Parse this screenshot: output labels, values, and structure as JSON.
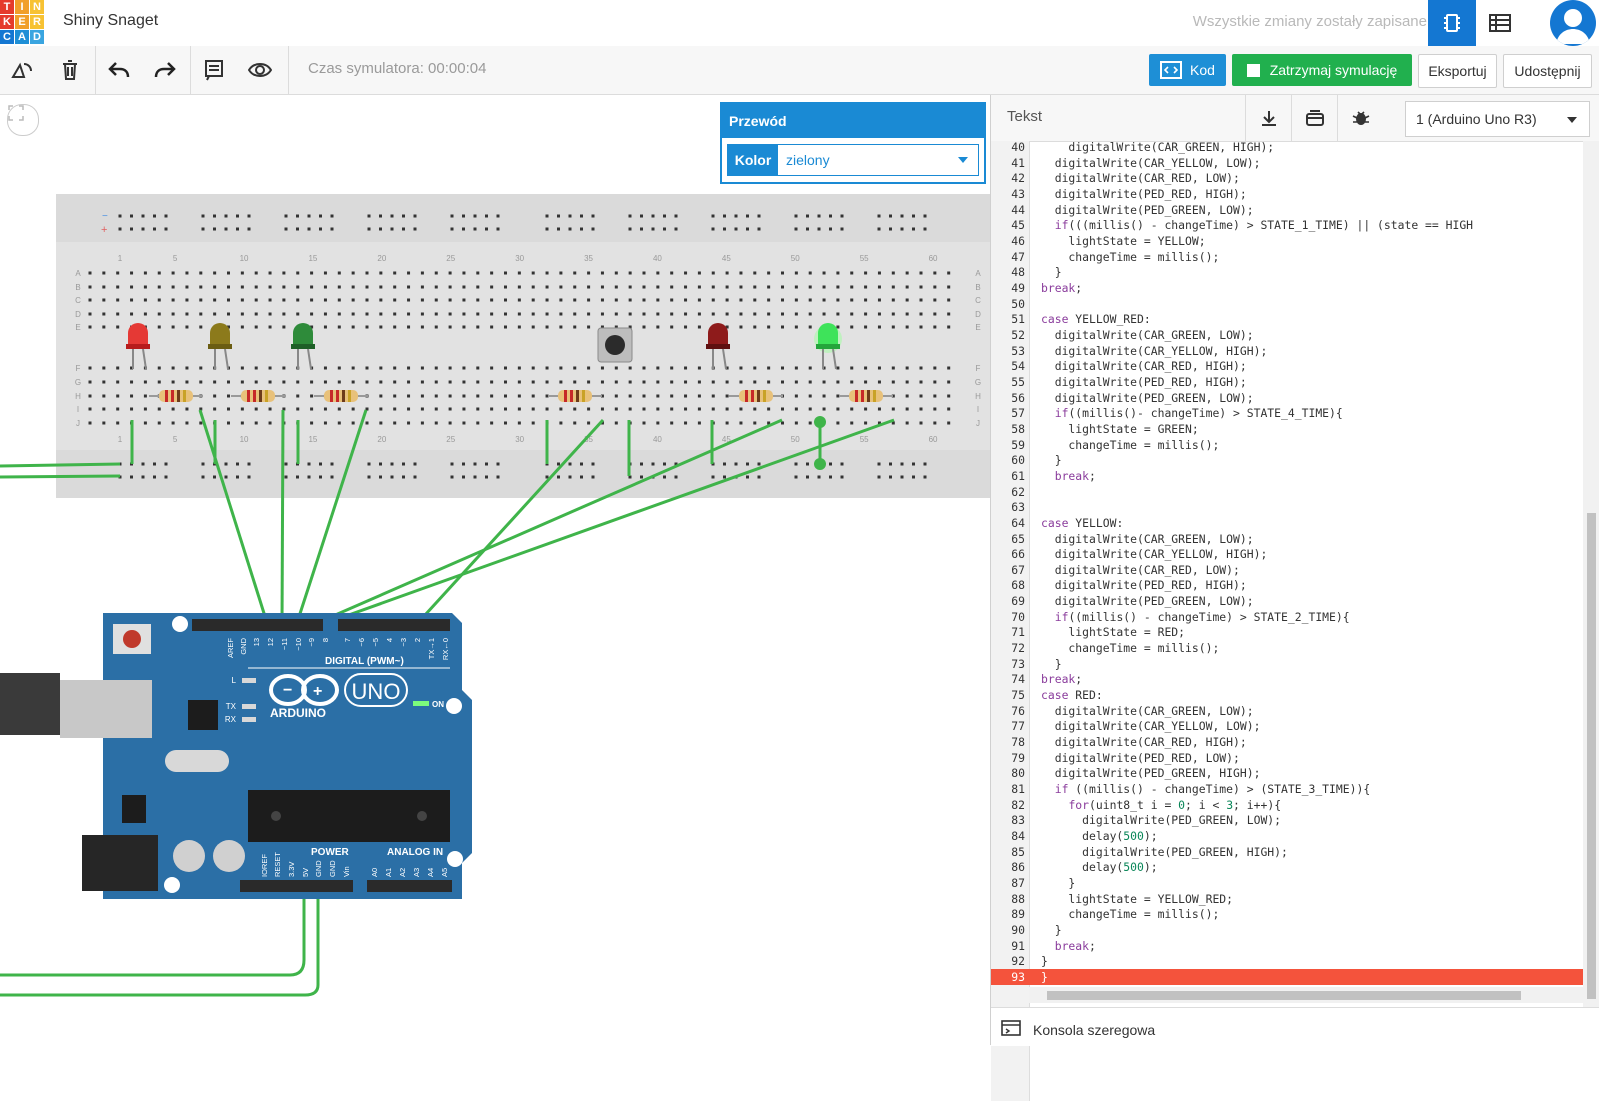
{
  "app": {
    "logo_letters": [
      "T",
      "I",
      "N",
      "K",
      "E",
      "R",
      "C",
      "A",
      "D"
    ],
    "project_name": "Shiny Snaget",
    "save_status": "Wszystkie zmiany zostały zapisane"
  },
  "toolbar": {
    "sim_time": "Czas symulatora: 00:00:04",
    "code_label": "Kod",
    "stop_label": "Zatrzymaj symulację",
    "export_label": "Eksportuj",
    "share_label": "Udostępnij"
  },
  "wire_panel": {
    "title": "Przewód",
    "color_label": "Kolor",
    "color_value": "zielony"
  },
  "code_panel": {
    "mode_label": "Tekst",
    "device": "1 (Arduino Uno R3)",
    "serial_label": "Konsola szeregowa",
    "lines": [
      {
        "n": "40",
        "t": "    digitalWrite(CAR_GREEN, HIGH);"
      },
      {
        "n": "41",
        "t": "  digitalWrite(CAR_YELLOW, LOW);"
      },
      {
        "n": "42",
        "t": "  digitalWrite(CAR_RED, LOW);"
      },
      {
        "n": "43",
        "t": "  digitalWrite(PED_RED, HIGH);"
      },
      {
        "n": "44",
        "t": "  digitalWrite(PED_GREEN, LOW);"
      },
      {
        "n": "45",
        "t": "  if(((millis() - changeTime) > STATE_1_TIME) || (state == HIGH"
      },
      {
        "n": "46",
        "t": "    lightState = YELLOW;"
      },
      {
        "n": "47",
        "t": "    changeTime = millis();"
      },
      {
        "n": "48",
        "t": "  }"
      },
      {
        "n": "49",
        "t": "break;"
      },
      {
        "n": "50",
        "t": ""
      },
      {
        "n": "51",
        "t": "case YELLOW_RED:"
      },
      {
        "n": "52",
        "t": "  digitalWrite(CAR_GREEN, LOW);"
      },
      {
        "n": "53",
        "t": "  digitalWrite(CAR_YELLOW, HIGH);"
      },
      {
        "n": "54",
        "t": "  digitalWrite(CAR_RED, HIGH);"
      },
      {
        "n": "55",
        "t": "  digitalWrite(PED_RED, HIGH);"
      },
      {
        "n": "56",
        "t": "  digitalWrite(PED_GREEN, LOW);"
      },
      {
        "n": "57",
        "t": "  if((millis()- changeTime) > STATE_4_TIME){"
      },
      {
        "n": "58",
        "t": "    lightState = GREEN;"
      },
      {
        "n": "59",
        "t": "    changeTime = millis();"
      },
      {
        "n": "60",
        "t": "  }"
      },
      {
        "n": "61",
        "t": "  break;"
      },
      {
        "n": "62",
        "t": ""
      },
      {
        "n": "63",
        "t": ""
      },
      {
        "n": "64",
        "t": "case YELLOW:"
      },
      {
        "n": "65",
        "t": "  digitalWrite(CAR_GREEN, LOW);"
      },
      {
        "n": "66",
        "t": "  digitalWrite(CAR_YELLOW, HIGH);"
      },
      {
        "n": "67",
        "t": "  digitalWrite(CAR_RED, LOW);"
      },
      {
        "n": "68",
        "t": "  digitalWrite(PED_RED, HIGH);"
      },
      {
        "n": "69",
        "t": "  digitalWrite(PED_GREEN, LOW);"
      },
      {
        "n": "70",
        "t": "  if((millis() - changeTime) > STATE_2_TIME){"
      },
      {
        "n": "71",
        "t": "    lightState = RED;"
      },
      {
        "n": "72",
        "t": "    changeTime = millis();"
      },
      {
        "n": "73",
        "t": "  }"
      },
      {
        "n": "74",
        "t": "break;"
      },
      {
        "n": "75",
        "t": "case RED:"
      },
      {
        "n": "76",
        "t": "  digitalWrite(CAR_GREEN, LOW);"
      },
      {
        "n": "77",
        "t": "  digitalWrite(CAR_YELLOW, LOW);"
      },
      {
        "n": "78",
        "t": "  digitalWrite(CAR_RED, HIGH);"
      },
      {
        "n": "79",
        "t": "  digitalWrite(PED_RED, LOW);"
      },
      {
        "n": "80",
        "t": "  digitalWrite(PED_GREEN, HIGH);"
      },
      {
        "n": "81",
        "t": "  if ((millis() - changeTime) > (STATE_3_TIME)){"
      },
      {
        "n": "82",
        "t": "    for(uint8_t i = 0; i < 3; i++){"
      },
      {
        "n": "83",
        "t": "      digitalWrite(PED_GREEN, LOW);"
      },
      {
        "n": "84",
        "t": "      delay(500);"
      },
      {
        "n": "85",
        "t": "      digitalWrite(PED_GREEN, HIGH);"
      },
      {
        "n": "86",
        "t": "      delay(500);"
      },
      {
        "n": "87",
        "t": "    }"
      },
      {
        "n": "88",
        "t": "    lightState = YELLOW_RED;"
      },
      {
        "n": "89",
        "t": "    changeTime = millis();"
      },
      {
        "n": "90",
        "t": "  }"
      },
      {
        "n": "91",
        "t": "  break;"
      },
      {
        "n": "92",
        "t": "}"
      },
      {
        "n": "93",
        "t": "}"
      }
    ],
    "error_line": "93"
  },
  "breadboard": {
    "col_numbers": [
      "1",
      "5",
      "10",
      "15",
      "20",
      "25",
      "30",
      "35",
      "40",
      "45",
      "50",
      "55",
      "60"
    ],
    "row_letters_top": [
      "A",
      "B",
      "C",
      "D",
      "E"
    ],
    "row_letters_bottom": [
      "F",
      "G",
      "H",
      "I",
      "J"
    ]
  },
  "arduino": {
    "brand": "ARDUINO",
    "model": "UNO",
    "on_label": "ON",
    "digital_label": "DIGITAL (PWM~)",
    "power_label": "POWER",
    "analog_label": "ANALOG IN",
    "digital_pins": [
      "AREF",
      "GND",
      "13",
      "12",
      "~11",
      "~10",
      "~9",
      "8",
      "7",
      "~6",
      "~5",
      "4",
      "~3",
      "2",
      "TX→1",
      "RX←0"
    ],
    "power_pins": [
      "IOREF",
      "RESET",
      "3.3V",
      "5V",
      "GND",
      "GND",
      "Vin"
    ],
    "analog_pins": [
      "A0",
      "A1",
      "A2",
      "A3",
      "A4",
      "A5"
    ],
    "led_labels": [
      "L",
      "TX",
      "RX"
    ]
  },
  "colors": {
    "accent": "#1477d2",
    "run_green": "#21b04e",
    "wire_green": "#3fb44a",
    "error_red": "#f4533c",
    "board_blue": "#2b6fa6"
  }
}
